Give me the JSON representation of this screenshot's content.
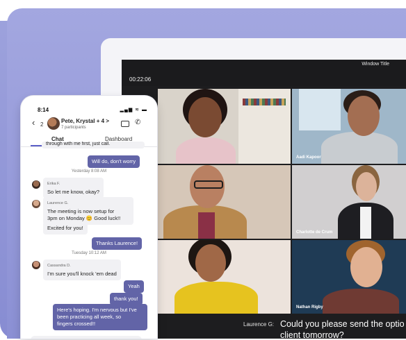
{
  "meeting": {
    "window_title": "Window Title",
    "timer": "00:22:06",
    "participants": [
      {
        "name": ""
      },
      {
        "name": "Aadi Kapoor"
      },
      {
        "name": ""
      },
      {
        "name": "Charlotte de Crum"
      },
      {
        "name": ""
      },
      {
        "name": "Nathan Rigby"
      }
    ],
    "caption": {
      "speaker": "Laurence G:",
      "line1": "Could you please send the optio",
      "line2": "client tomorrow?"
    }
  },
  "phone": {
    "time": "8:14",
    "status_icons": "▂▄▆ ≋ ▬",
    "back_count": "2",
    "conversation_title": "Pete, Krystal + 4 >",
    "participants_count": "7 participants",
    "tabs": [
      "Chat",
      "Dashboard"
    ],
    "messages": {
      "cut": "through with me first, just call.",
      "m1": "Will do, don't worry",
      "stamp1": "Yesterday 8:08 AM",
      "erika_sender": "Erika F.",
      "erika_text": "So let me know, okay?",
      "laurence_sender": "Laurence G.",
      "laurence_text1": "The meeting is now setup for",
      "laurence_text2": "3pm on Monday 😊 Good luck!!",
      "laurence_text3": "Excited for you!",
      "m2": "Thanks Laurence!",
      "stamp2": "Tuesday 10:12 AM",
      "cassandra_sender": "Cassandra D.",
      "cassandra_text": "I'm sure you'll knock 'em dead",
      "m3": "Yeah",
      "m4": "thank you!",
      "m5_1": "Here's hoping. I'm nervous but I've",
      "m5_2": "been practicing all week, so",
      "m5_3": "fingers crossed!!"
    }
  }
}
